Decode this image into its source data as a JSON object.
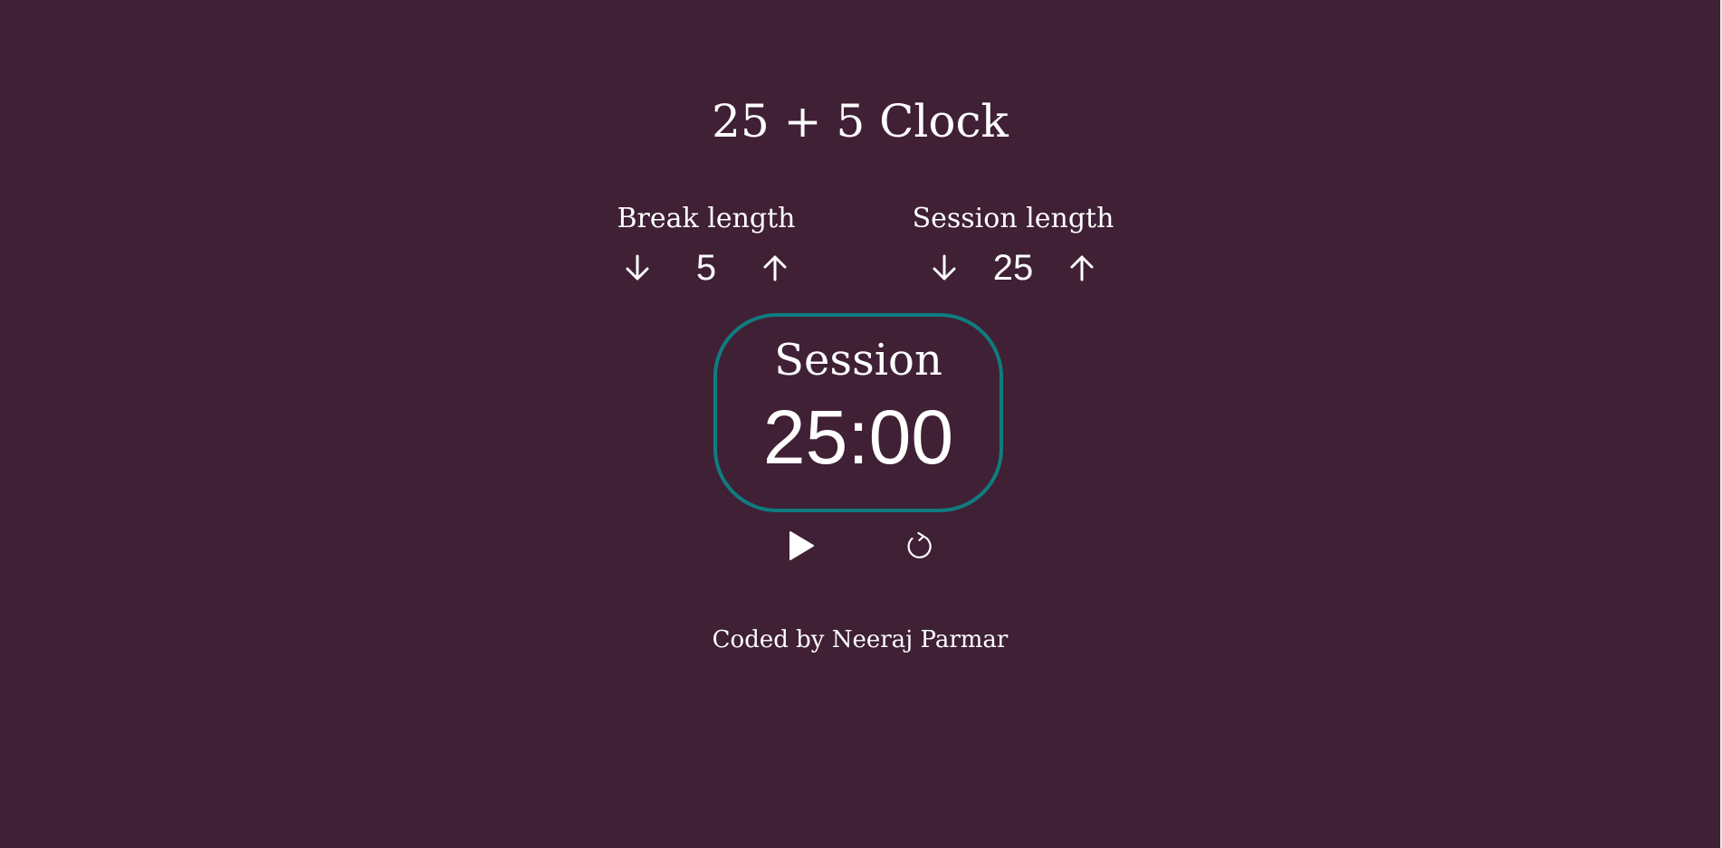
{
  "app": {
    "title": "25 + 5 Clock",
    "background_color": "#3f2035",
    "accent_color": "#107c7f"
  },
  "break": {
    "label": "Break length",
    "value": "5",
    "decrement_icon": "arrow-down-icon",
    "increment_icon": "arrow-up-icon"
  },
  "session": {
    "label": "Session length",
    "value": "25",
    "decrement_icon": "arrow-down-icon",
    "increment_icon": "arrow-up-icon"
  },
  "timer": {
    "label": "Session",
    "time_left": "25:00"
  },
  "playback": {
    "play_icon": "play-icon",
    "reset_icon": "refresh-icon"
  },
  "footer": {
    "text": "Coded by Neeraj Parmar"
  }
}
